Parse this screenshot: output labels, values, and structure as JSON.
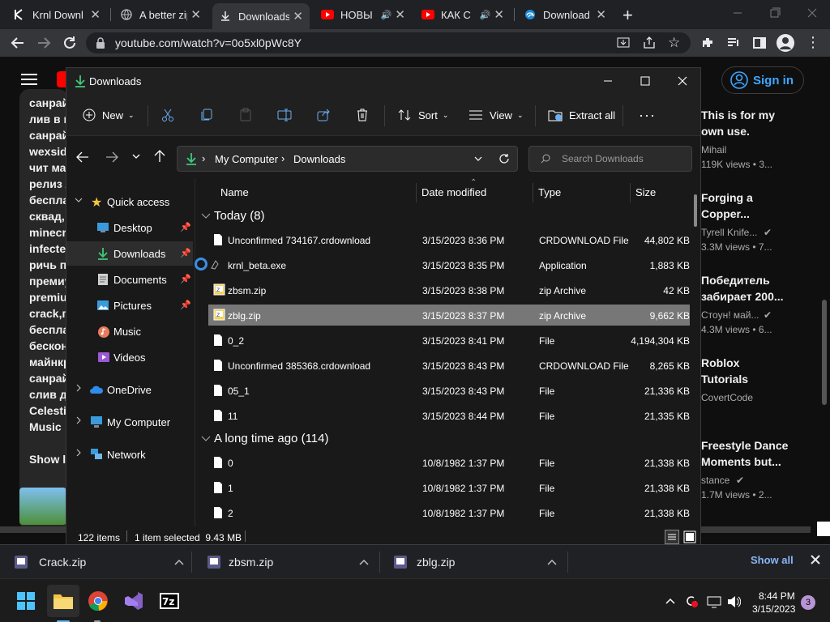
{
  "browser": {
    "tabs": [
      {
        "label": "Krnl Downl",
        "icon": "krnl-icon"
      },
      {
        "label": "A better zip",
        "icon": "globe-icon"
      },
      {
        "label": "Downloads",
        "icon": "download-icon",
        "active": true
      },
      {
        "label": "НОВЫ",
        "icon": "youtube-icon",
        "audio": true
      },
      {
        "label": "КАК С",
        "icon": "youtube-icon",
        "audio": true
      },
      {
        "label": "Download",
        "icon": "edge-icon"
      }
    ],
    "url": "youtube.com/watch?v=0o5xl0pWc8Y"
  },
  "youtube": {
    "sign_in": "Sign in",
    "description_lines": [
      "санрай",
      "лив в к",
      "санрай",
      "wexside",
      "чит ма",
      "релиз л",
      "беспла",
      "сквад,",
      "minecra",
      "infecte",
      "ричь пр",
      "премиу",
      "premiu",
      "crack,п",
      "бесплат",
      "бескон",
      "майнкр",
      "санрай",
      "слив до",
      "Celesti",
      "Music"
    ],
    "show_less": "Show le",
    "recommendations": [
      {
        "title1": "This is for my",
        "title2": "own use.",
        "channel": "Mihail",
        "meta": "119K views • 3..."
      },
      {
        "title1": "Forging a",
        "title2": "Copper...",
        "channel": "Tyrell Knife...",
        "meta": "3.3M views • 7..."
      },
      {
        "title1": "Победитель",
        "title2": "забирает 200...",
        "channel": "Стоун! май...",
        "meta": "4.3M views • 6..."
      },
      {
        "title1": "Roblox",
        "title2": "Tutorials",
        "channel": "CovertCode",
        "meta": ""
      },
      {
        "title1": "Freestyle Dance",
        "title2": "Moments but...",
        "channel": "stance",
        "meta": "1.7M views • 2..."
      }
    ]
  },
  "explorer": {
    "title": "Downloads",
    "toolbar": {
      "new": "New",
      "sort": "Sort",
      "view": "View",
      "extract_all": "Extract all"
    },
    "path": [
      "My Computer",
      "Downloads"
    ],
    "search_placeholder": "Search Downloads",
    "nav": [
      {
        "label": "Quick access",
        "icon": "star-icon"
      },
      {
        "label": "Desktop",
        "icon": "desktop-icon",
        "pinned": true
      },
      {
        "label": "Downloads",
        "icon": "download-icon",
        "pinned": true,
        "selected": true
      },
      {
        "label": "Documents",
        "icon": "document-icon",
        "pinned": true
      },
      {
        "label": "Pictures",
        "icon": "pictures-icon",
        "pinned": true
      },
      {
        "label": "Music",
        "icon": "music-icon"
      },
      {
        "label": "Videos",
        "icon": "videos-icon"
      },
      {
        "label": "OneDrive",
        "icon": "cloud-icon"
      },
      {
        "label": "My Computer",
        "icon": "computer-icon"
      },
      {
        "label": "Network",
        "icon": "network-icon"
      }
    ],
    "columns": {
      "name": "Name",
      "date": "Date modified",
      "type": "Type",
      "size": "Size"
    },
    "groups": [
      {
        "label": "Today (8)"
      },
      {
        "label": "A long time ago (114)"
      }
    ],
    "files_today": [
      {
        "name": "Unconfirmed 734167.crdownload",
        "date": "3/15/2023 8:36 PM",
        "type": "CRDOWNLOAD File",
        "size": "44,802 KB",
        "icon": "file-icon"
      },
      {
        "name": "krnl_beta.exe",
        "date": "3/15/2023 8:35 PM",
        "type": "Application",
        "size": "1,883 KB",
        "icon": "exe-icon"
      },
      {
        "name": "zbsm.zip",
        "date": "3/15/2023 8:38 PM",
        "type": "zip Archive",
        "size": "42 KB",
        "icon": "zip-icon"
      },
      {
        "name": "zblg.zip",
        "date": "3/15/2023 8:37 PM",
        "type": "zip Archive",
        "size": "9,662 KB",
        "icon": "zip-icon",
        "selected": true
      },
      {
        "name": "0_2",
        "date": "3/15/2023 8:41 PM",
        "type": "File",
        "size": "4,194,304 KB",
        "icon": "file-icon"
      },
      {
        "name": "Unconfirmed 385368.crdownload",
        "date": "3/15/2023 8:43 PM",
        "type": "CRDOWNLOAD File",
        "size": "8,265 KB",
        "icon": "file-icon"
      },
      {
        "name": "05_1",
        "date": "3/15/2023 8:43 PM",
        "type": "File",
        "size": "21,336 KB",
        "icon": "file-icon"
      },
      {
        "name": "11",
        "date": "3/15/2023 8:44 PM",
        "type": "File",
        "size": "21,335 KB",
        "icon": "file-icon"
      }
    ],
    "files_old": [
      {
        "name": "0",
        "date": "10/8/1982 1:37 PM",
        "type": "File",
        "size": "21,338 KB",
        "icon": "file-icon"
      },
      {
        "name": "1",
        "date": "10/8/1982 1:37 PM",
        "type": "File",
        "size": "21,338 KB",
        "icon": "file-icon"
      },
      {
        "name": "2",
        "date": "10/8/1982 1:37 PM",
        "type": "File",
        "size": "21,338 KB",
        "icon": "file-icon"
      }
    ],
    "status": {
      "items": "122 items",
      "selected": "1 item selected  9.43 MB"
    }
  },
  "download_shelf": {
    "items": [
      "Crack.zip",
      "zbsm.zip",
      "zblg.zip"
    ],
    "show_all": "Show all"
  },
  "taskbar": {
    "time": "8:44 PM",
    "date": "3/15/2023",
    "notifications": "3"
  }
}
